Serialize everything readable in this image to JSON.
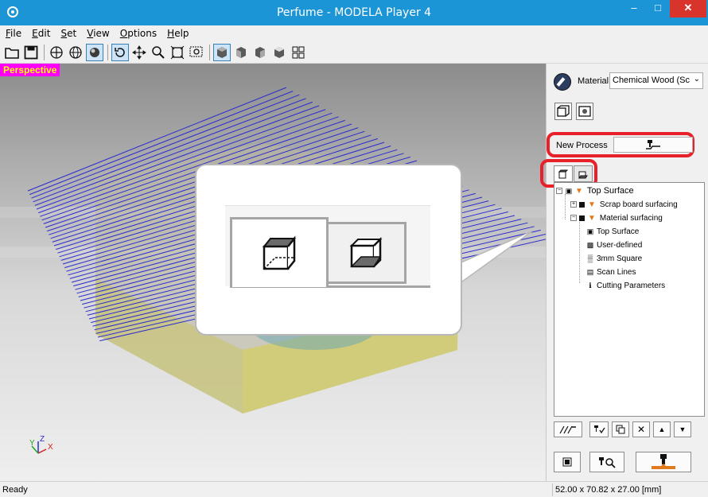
{
  "window": {
    "title": "Perfume - MODELA Player 4",
    "minimize_glyph": "–",
    "maximize_glyph": "□",
    "close_glyph": "✕"
  },
  "menu": [
    {
      "underline": "F",
      "rest": "ile"
    },
    {
      "underline": "E",
      "rest": "dit"
    },
    {
      "underline": "S",
      "rest": "et"
    },
    {
      "underline": "V",
      "rest": "iew"
    },
    {
      "underline": "O",
      "rest": "ptions"
    },
    {
      "underline": "H",
      "rest": "elp"
    }
  ],
  "toolbar": {
    "icons": [
      "folder-open-icon",
      "save-icon",
      "globe-wire-icon",
      "globe-icon",
      "sphere-shaded-icon",
      "rotate-icon",
      "pan-icon",
      "zoom-icon",
      "fit-icon",
      "zoom-box-icon",
      "view-iso-icon",
      "view-front-icon",
      "view-side-icon",
      "view-top-icon",
      "multi-view-icon"
    ]
  },
  "viewport": {
    "mode_label": "Perspective",
    "axis_z": "Z",
    "axis_y": "Y",
    "axis_x": "X"
  },
  "panel": {
    "material_label": "Material",
    "material_value": "Chemical Wood (Sc",
    "new_process_label": "New Process",
    "tree": [
      {
        "label": "Top Surface"
      },
      {
        "label": "Scrap board surfacing"
      },
      {
        "label": "Material surfacing"
      },
      {
        "label": "Top Surface"
      },
      {
        "label": "User-defined"
      },
      {
        "label": "3mm Square"
      },
      {
        "label": "Scan Lines"
      },
      {
        "label": "Cutting Parameters"
      }
    ],
    "expander_plus": "+",
    "expander_minus": "−",
    "toolbar_glyphs": {
      "delete": "✕",
      "up": "▲",
      "down": "▼"
    }
  },
  "status": {
    "text": "Ready",
    "dimensions": "52.00 x 70.82 x 27.00 [mm]"
  },
  "colors": {
    "titlebar": "#1c95d6",
    "close": "#d9342c",
    "highlight": "#e8202a",
    "label_bg": "#ff00ff",
    "label_fg": "#ffff00",
    "scanlines": "#2a2ad0",
    "block": "#c9c46a"
  }
}
